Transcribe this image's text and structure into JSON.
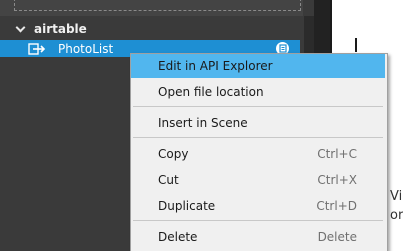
{
  "tree": {
    "group_label": "airtable",
    "selected_item_label": "PhotoList",
    "item_icon": "connector-arrow-icon",
    "badge_icon": "document-badge-icon"
  },
  "context_menu": {
    "items": [
      {
        "label": "Edit in API Explorer",
        "shortcut": ""
      },
      {
        "label": "Open file location",
        "shortcut": ""
      },
      {
        "label": "Insert in Scene",
        "shortcut": ""
      },
      {
        "label": "Copy",
        "shortcut": "Ctrl+C"
      },
      {
        "label": "Cut",
        "shortcut": "Ctrl+X"
      },
      {
        "label": "Duplicate",
        "shortcut": "Ctrl+D"
      },
      {
        "label": "Delete",
        "shortcut": "Delete"
      }
    ]
  },
  "background_text": {
    "line1": "Vi",
    "line2": "or"
  },
  "colors": {
    "panel": "#3a3a3a",
    "selection": "#1e8fd3",
    "menu_highlight": "#51b6ee",
    "menu_background": "#f0f0f0"
  }
}
